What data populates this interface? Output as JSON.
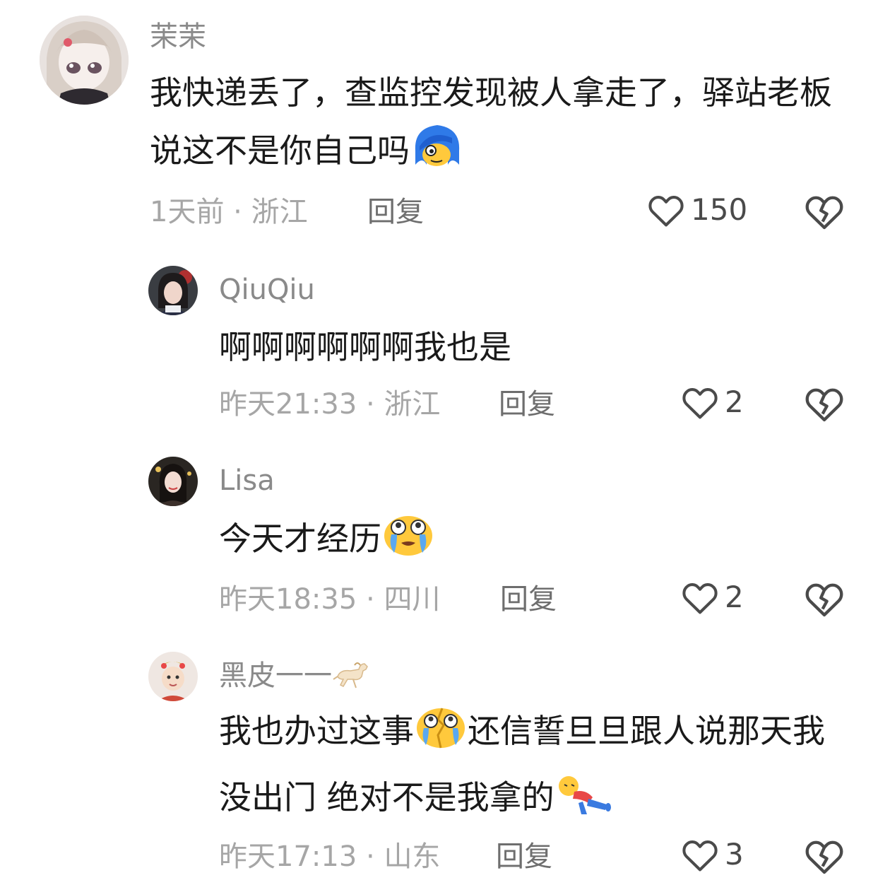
{
  "comments": [
    {
      "username": "茉茉",
      "text": "我快递丢了，查监控发现被人拿走了，驿站老板说这不是你自己吗",
      "time": "1天前",
      "location": "浙江",
      "reply_label": "回复",
      "likes": "150"
    },
    {
      "username": "QiuQiu",
      "text": "啊啊啊啊啊啊我也是",
      "time": "昨天21:33",
      "location": "浙江",
      "reply_label": "回复",
      "likes": "2"
    },
    {
      "username": "Lisa",
      "text": "今天才经历",
      "time": "昨天18:35",
      "location": "四川",
      "reply_label": "回复",
      "likes": "2"
    },
    {
      "username": "黑皮一一",
      "text_part1": "我也办过这事",
      "text_part2": "还信誓旦旦跟人说那天我没出门 绝对不是我拿的",
      "time": "昨天17:13",
      "location": "山东",
      "reply_label": "回复",
      "likes": "3"
    }
  ],
  "separator": " · ",
  "icons": {
    "like": "heart-outline-icon",
    "dislike": "broken-heart-icon"
  },
  "colors": {
    "username": "#8a8a8a",
    "meta": "#a6a6a6",
    "icon": "#4a4a4a"
  }
}
